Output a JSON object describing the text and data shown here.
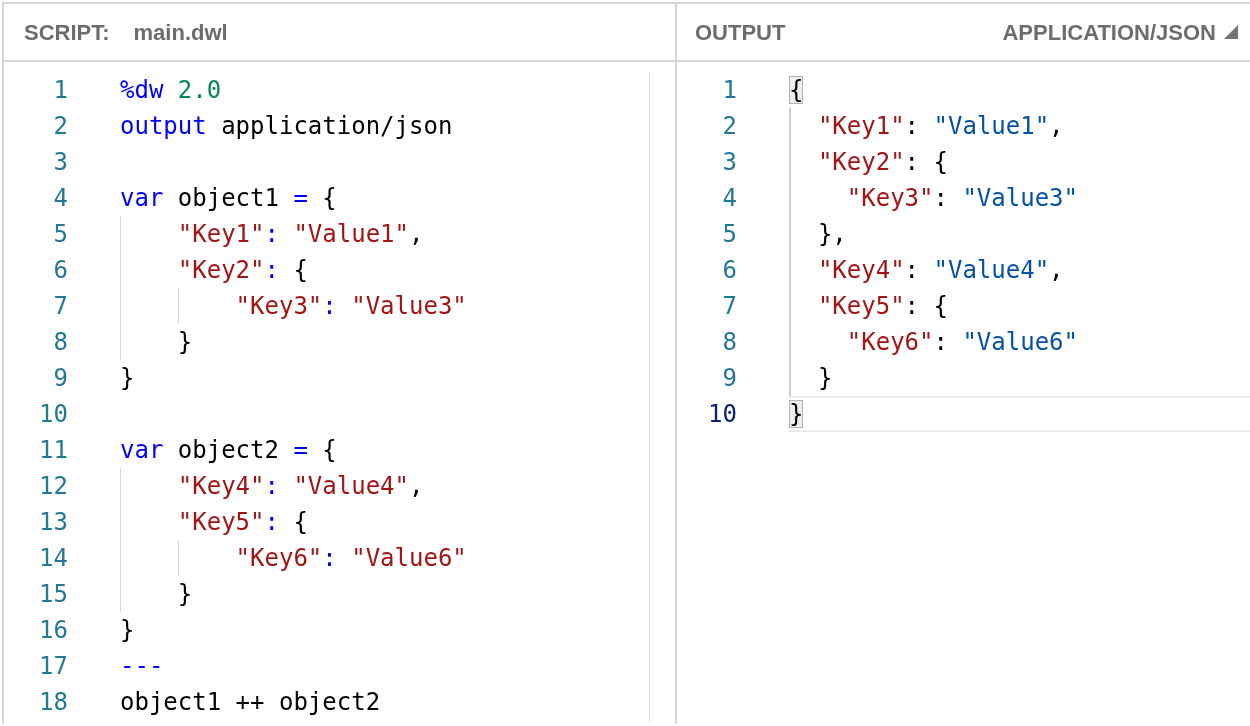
{
  "panes": [
    {
      "kind": "script",
      "title": "SCRIPT:",
      "file_name": "main.dwl",
      "lines": [
        {
          "number": "1",
          "tokens": [
            {
              "kind": "keyword",
              "text": "%dw"
            },
            {
              "kind": "number",
              "text": " 2.0"
            }
          ]
        },
        {
          "number": "2",
          "tokens": [
            {
              "kind": "keyword",
              "text": "output"
            },
            {
              "kind": "plain",
              "text": " application/json"
            }
          ]
        },
        {
          "number": "3"
        },
        {
          "number": "4",
          "tokens": [
            {
              "kind": "keyword",
              "text": "var"
            },
            {
              "kind": "plain",
              "text": " object1 "
            },
            {
              "kind": "operator",
              "text": "="
            },
            {
              "kind": "plain",
              "text": " {"
            }
          ],
          "children": [
            {
              "number": "5",
              "tokens": [
                {
                  "kind": "string",
                  "text": "\"Key1\""
                },
                {
                  "kind": "operator",
                  "text": ":"
                },
                {
                  "kind": "string",
                  "text": " \"Value1\""
                },
                {
                  "kind": "plain",
                  "text": ","
                }
              ]
            },
            {
              "number": "6",
              "tokens": [
                {
                  "kind": "string",
                  "text": "\"Key2\""
                },
                {
                  "kind": "operator",
                  "text": ":"
                },
                {
                  "kind": "plain",
                  "text": " {"
                }
              ],
              "children": [
                {
                  "number": "7",
                  "tokens": [
                    {
                      "kind": "string",
                      "text": "\"Key3\""
                    },
                    {
                      "kind": "operator",
                      "text": ":"
                    },
                    {
                      "kind": "string",
                      "text": " \"Value3\""
                    }
                  ]
                }
              ]
            },
            {
              "number": "8",
              "tokens": [
                {
                  "kind": "plain",
                  "text": "}"
                }
              ]
            }
          ]
        },
        {
          "number": "9",
          "tokens": [
            {
              "kind": "plain",
              "text": "}"
            }
          ]
        },
        {
          "number": "10"
        },
        {
          "number": "11",
          "tokens": [
            {
              "kind": "keyword",
              "text": "var"
            },
            {
              "kind": "plain",
              "text": " object2 "
            },
            {
              "kind": "operator",
              "text": "="
            },
            {
              "kind": "plain",
              "text": " {"
            }
          ],
          "children": [
            {
              "number": "12",
              "tokens": [
                {
                  "kind": "string",
                  "text": "\"Key4\""
                },
                {
                  "kind": "operator",
                  "text": ":"
                },
                {
                  "kind": "string",
                  "text": " \"Value4\""
                },
                {
                  "kind": "plain",
                  "text": ","
                }
              ]
            },
            {
              "number": "13",
              "tokens": [
                {
                  "kind": "string",
                  "text": "\"Key5\""
                },
                {
                  "kind": "operator",
                  "text": ":"
                },
                {
                  "kind": "plain",
                  "text": " {"
                }
              ],
              "children": [
                {
                  "number": "14",
                  "tokens": [
                    {
                      "kind": "string",
                      "text": "\"Key6\""
                    },
                    {
                      "kind": "operator",
                      "text": ":"
                    },
                    {
                      "kind": "string",
                      "text": " \"Value6\""
                    }
                  ]
                }
              ]
            },
            {
              "number": "15",
              "tokens": [
                {
                  "kind": "plain",
                  "text": "}"
                }
              ]
            }
          ]
        },
        {
          "number": "16",
          "tokens": [
            {
              "kind": "plain",
              "text": "}"
            }
          ]
        },
        {
          "number": "17",
          "tokens": [
            {
              "kind": "operator",
              "text": "---"
            }
          ]
        },
        {
          "number": "18",
          "tokens": [
            {
              "kind": "plain",
              "text": "object1 ++ object2"
            }
          ]
        }
      ]
    },
    {
      "kind": "output",
      "title": "OUTPUT",
      "format": "APPLICATION/JSON",
      "lines": [
        {
          "number": "1",
          "current": false,
          "tokens": [
            {
              "kind": "matched_bracket",
              "text": "{"
            }
          ],
          "children": [
            {
              "number": "2",
              "current": false,
              "tokens": [
                {
                  "kind": "key",
                  "text": "\"Key1\""
                },
                {
                  "kind": "plain",
                  "text": ":"
                },
                {
                  "kind": "value",
                  "text": " \"Value1\""
                },
                {
                  "kind": "plain",
                  "text": ","
                }
              ]
            },
            {
              "number": "3",
              "current": false,
              "tokens": [
                {
                  "kind": "key",
                  "text": "\"Key2\""
                },
                {
                  "kind": "plain",
                  "text": ": {"
                }
              ],
              "children": [
                {
                  "number": "4",
                  "current": false,
                  "tokens": [
                    {
                      "kind": "key",
                      "text": "\"Key3\""
                    },
                    {
                      "kind": "plain",
                      "text": ":"
                    },
                    {
                      "kind": "value",
                      "text": " \"Value3\""
                    }
                  ]
                }
              ]
            },
            {
              "number": "5",
              "current": false,
              "tokens": [
                {
                  "kind": "plain",
                  "text": "},"
                }
              ]
            },
            {
              "number": "6",
              "current": false,
              "tokens": [
                {
                  "kind": "key",
                  "text": "\"Key4\""
                },
                {
                  "kind": "plain",
                  "text": ":"
                },
                {
                  "kind": "value",
                  "text": " \"Value4\""
                },
                {
                  "kind": "plain",
                  "text": ","
                }
              ]
            },
            {
              "number": "7",
              "current": false,
              "tokens": [
                {
                  "kind": "key",
                  "text": "\"Key5\""
                },
                {
                  "kind": "plain",
                  "text": ": {"
                }
              ],
              "children": [
                {
                  "number": "8",
                  "current": false,
                  "tokens": [
                    {
                      "kind": "key",
                      "text": "\"Key6\""
                    },
                    {
                      "kind": "plain",
                      "text": ":"
                    },
                    {
                      "kind": "value",
                      "text": " \"Value6\""
                    }
                  ]
                }
              ]
            },
            {
              "number": "9",
              "current": false,
              "tokens": [
                {
                  "kind": "plain",
                  "text": "}"
                }
              ]
            }
          ]
        },
        {
          "number": "10",
          "current": true,
          "tokens": [
            {
              "kind": "matched_bracket",
              "text": "}"
            }
          ]
        }
      ]
    }
  ]
}
